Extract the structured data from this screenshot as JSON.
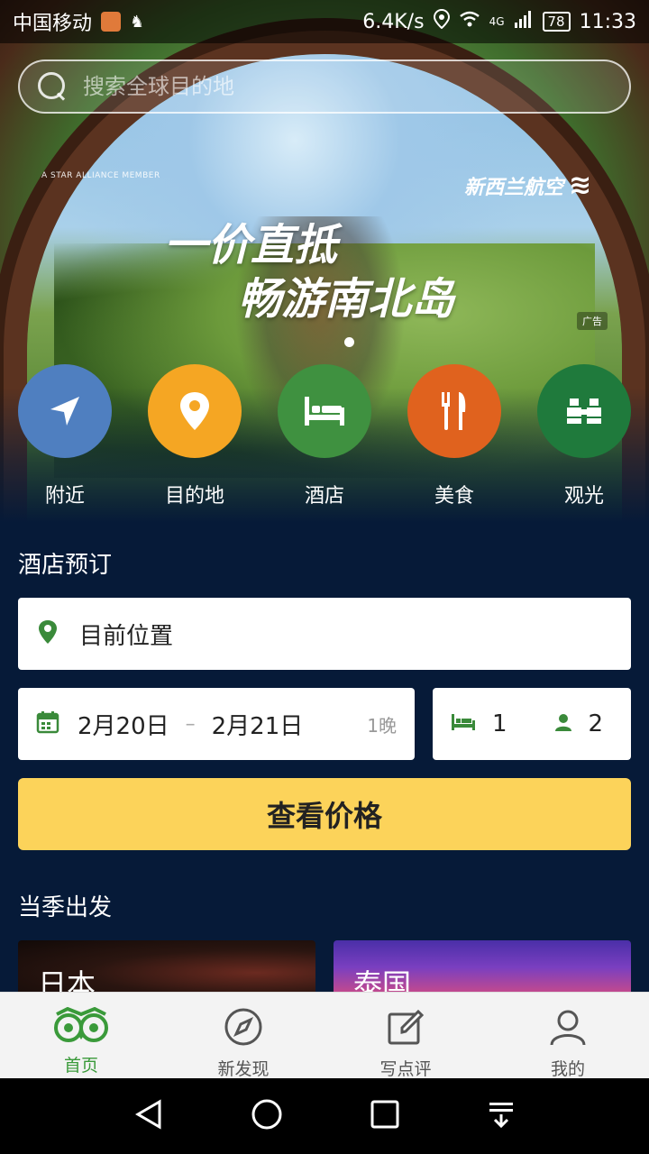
{
  "status_bar": {
    "carrier": "中国移动",
    "network_speed": "6.4K/s",
    "signal_type": "4G",
    "battery": "78",
    "time": "11:33"
  },
  "search": {
    "placeholder": "搜索全球目的地"
  },
  "banner": {
    "alliance_text": "A STAR ALLIANCE MEMBER",
    "airline_name": "新西兰航空",
    "headline_line1": "一价直抵",
    "headline_line2": "畅游南北岛",
    "ad_tag": "广告"
  },
  "categories": [
    {
      "label": "附近",
      "icon": "navigation-arrow-icon",
      "color": "#4f7fc0"
    },
    {
      "label": "目的地",
      "icon": "map-pin-icon",
      "color": "#f5a623"
    },
    {
      "label": "酒店",
      "icon": "bed-icon",
      "color": "#3f9140"
    },
    {
      "label": "美食",
      "icon": "fork-knife-icon",
      "color": "#e0621e"
    },
    {
      "label": "观光",
      "icon": "binoculars-icon",
      "color": "#1f7a3c"
    }
  ],
  "hotel_booking": {
    "title": "酒店预订",
    "location": "目前位置",
    "check_in": "2月20日",
    "date_separator": "–",
    "check_out": "2月21日",
    "nights": "1晚",
    "rooms": "1",
    "guests": "2",
    "button_label": "查看价格",
    "accent_color": "#fcd35a"
  },
  "seasonal": {
    "title": "当季出发",
    "cards": [
      {
        "label": "日本"
      },
      {
        "label": "泰国"
      }
    ]
  },
  "tab_bar": {
    "items": [
      {
        "label": "首页",
        "icon": "owl-logo-icon",
        "active": true
      },
      {
        "label": "新发现",
        "icon": "compass-icon",
        "active": false
      },
      {
        "label": "写点评",
        "icon": "edit-note-icon",
        "active": false
      },
      {
        "label": "我的",
        "icon": "person-icon",
        "active": false
      }
    ]
  }
}
